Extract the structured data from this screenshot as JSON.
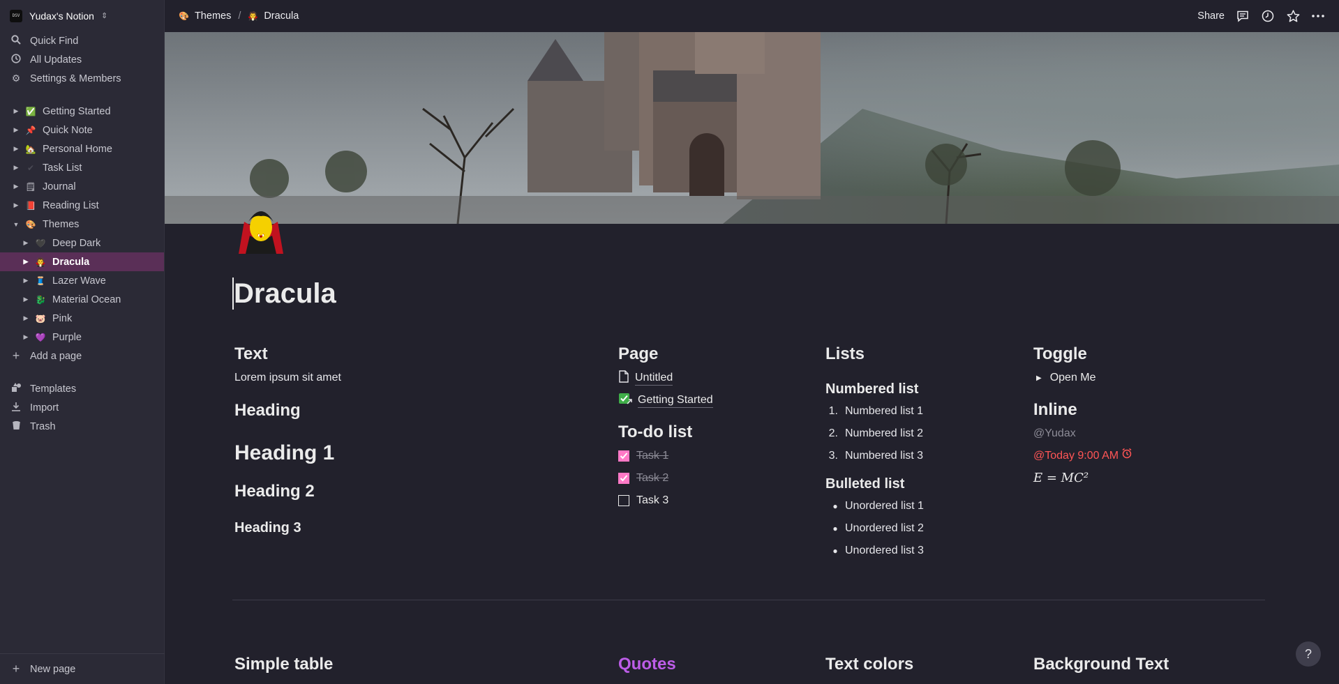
{
  "workspace": {
    "name": "Yudax's Notion",
    "logo_text": "DSV"
  },
  "sidebar": {
    "top": [
      {
        "label": "Quick Find",
        "icon": "search-icon"
      },
      {
        "label": "All Updates",
        "icon": "clock-icon"
      },
      {
        "label": "Settings & Members",
        "icon": "gear-icon"
      }
    ],
    "pages": [
      {
        "label": "Getting Started",
        "emoji": "✅"
      },
      {
        "label": "Quick Note",
        "emoji": "📌"
      },
      {
        "label": "Personal Home",
        "emoji": "🏡"
      },
      {
        "label": "Task List",
        "emoji": "✔"
      },
      {
        "label": "Journal",
        "emoji": "🗒"
      },
      {
        "label": "Reading List",
        "emoji": "📕"
      },
      {
        "label": "Themes",
        "emoji": "🎨"
      }
    ],
    "theme_children": [
      {
        "label": "Deep Dark",
        "emoji": "🖤"
      },
      {
        "label": "Dracula",
        "emoji": "🧛"
      },
      {
        "label": "Lazer Wave",
        "emoji": "🧵"
      },
      {
        "label": "Material Ocean",
        "emoji": "🐉"
      },
      {
        "label": "Pink",
        "emoji": "🐷"
      },
      {
        "label": "Purple",
        "emoji": "💜"
      }
    ],
    "add_page": "Add a page",
    "bottom": [
      {
        "label": "Templates",
        "icon": "templates-icon"
      },
      {
        "label": "Import",
        "icon": "import-icon"
      },
      {
        "label": "Trash",
        "icon": "trash-icon"
      }
    ],
    "new_page": "New page"
  },
  "topbar": {
    "breadcrumb": [
      {
        "label": "Themes",
        "emoji": "🎨"
      },
      {
        "label": "Dracula",
        "emoji": "🧛"
      }
    ],
    "separator": "/",
    "share": "Share"
  },
  "page": {
    "title": "Dracula",
    "text_col": {
      "heading": "Text",
      "body": "Lorem ipsum sit amet",
      "heading_plain": "Heading",
      "heading_1": "Heading 1",
      "heading_2": "Heading 2",
      "heading_3": "Heading 3"
    },
    "page_col": {
      "heading": "Page",
      "links": [
        "Untitled",
        "Getting Started"
      ],
      "todo_heading": "To-do list",
      "todos": [
        {
          "label": "Task 1",
          "checked": true
        },
        {
          "label": "Task 2",
          "checked": true
        },
        {
          "label": "Task 3",
          "checked": false
        }
      ]
    },
    "lists_col": {
      "heading": "Lists",
      "numbered_heading": "Numbered list",
      "numbered": [
        "Numbered list 1",
        "Numbered list 2",
        "Numbered list 3"
      ],
      "bulleted_heading": "Bulleted list",
      "bulleted": [
        "Unordered list 1",
        "Unordered list 2",
        "Unordered list 3"
      ]
    },
    "toggle_col": {
      "heading": "Toggle",
      "toggle_label": "Open Me",
      "inline_heading": "Inline",
      "mention": "@Yudax",
      "date": "@Today 9:00 AM",
      "math": "E = MC²"
    },
    "bottom_headings": [
      "Simple table",
      "Quotes",
      "Text colors",
      "Background Text"
    ]
  },
  "colors": {
    "accent": "#ff79c6",
    "danger": "#ff5555",
    "quotes": "#bd5de8",
    "active_bg": "#5a2f57"
  },
  "help": "?"
}
